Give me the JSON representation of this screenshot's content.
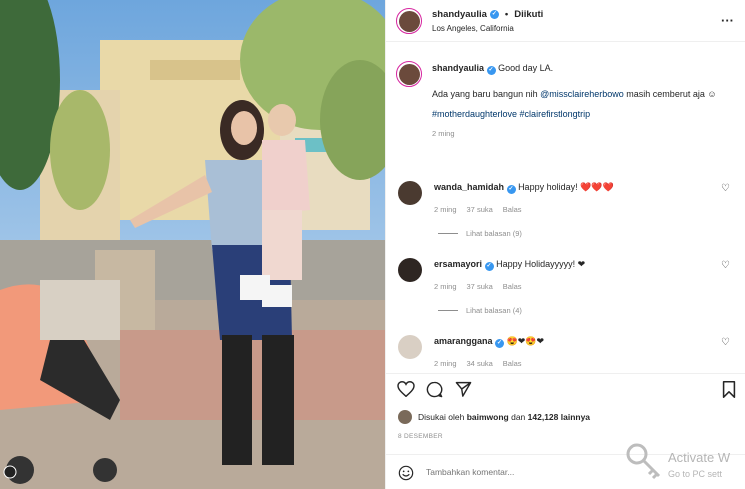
{
  "post": {
    "username": "shandyaulia",
    "follow_status": "Diikuti",
    "location": "Los Angeles, California",
    "caption_greeting": "Good day LA.",
    "caption_line1_pre": "Ada yang baru bangun nih",
    "caption_mention": "@missclaireherbowo",
    "caption_line1_post": "masih cemberut aja ☺",
    "caption_hashtags": "#motherdaughterlove #clairefirstlongtrip",
    "caption_time": "2 ming"
  },
  "comments": [
    {
      "username": "wanda_hamidah",
      "text": "Happy holiday! ❤️❤️❤️",
      "time": "2 ming",
      "likes": "37 suka",
      "reply": "Balas",
      "view_replies": "Lihat balasan (9)"
    },
    {
      "username": "ersamayori",
      "text": "Happy Holidayyyyy! ❤",
      "time": "2 ming",
      "likes": "37 suka",
      "reply": "Balas",
      "view_replies": "Lihat balasan (4)"
    },
    {
      "username": "amaranggana",
      "text": "😍❤😍❤",
      "time": "2 ming",
      "likes": "34 suka",
      "reply": "Balas"
    }
  ],
  "likes": {
    "prefix": "Disukai oleh",
    "user": "baimwong",
    "middle": "dan",
    "count": "142,128 lainnya"
  },
  "date": "8 DESEMBER",
  "add_comment": {
    "placeholder": "Tambahkan komentar..."
  },
  "watermark": {
    "title": "Activate W",
    "subtitle": "Go to PC sett"
  },
  "icons": [
    "heart-icon",
    "comment-icon",
    "share-icon",
    "bookmark-icon",
    "more-icon",
    "emoji-icon",
    "verified-icon"
  ]
}
